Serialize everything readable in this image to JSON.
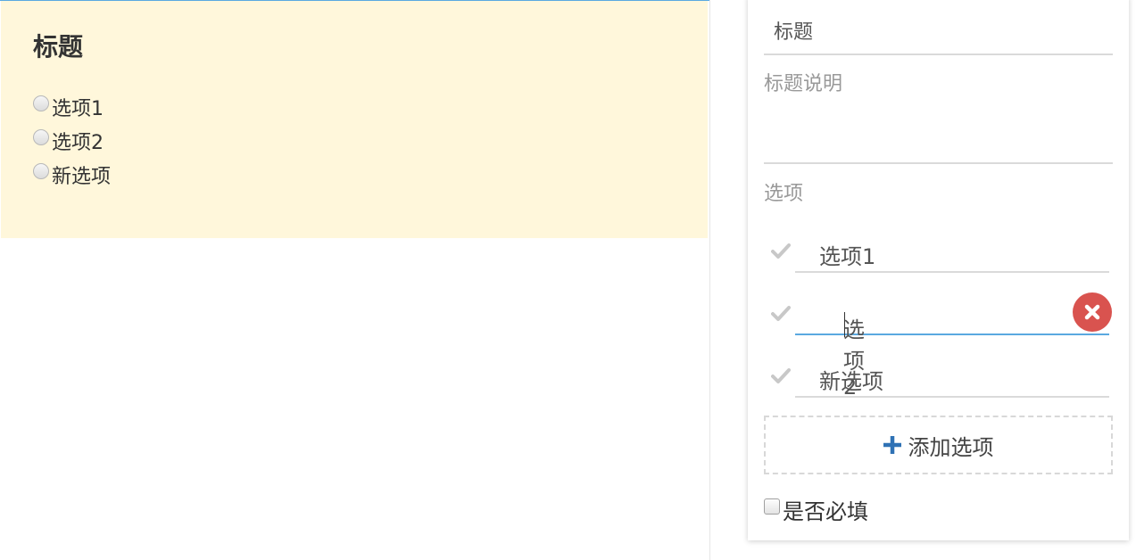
{
  "preview": {
    "title": "标题",
    "options": [
      "选项1",
      "选项2",
      "新选项"
    ]
  },
  "editor": {
    "title_value": "标题",
    "description_label": "标题说明",
    "options_label": "选项",
    "options": [
      "选项1",
      "选项2",
      "新选项"
    ],
    "add_option_label": "添加选项",
    "required_label": "是否必填"
  },
  "icons": {
    "check": "check-icon",
    "delete": "close-circle-icon",
    "add": "plus-icon"
  },
  "colors": {
    "preview_bg": "#fff7db",
    "accent": "#5aa9e0",
    "delete": "#d9534f",
    "plus": "#2f72b5"
  }
}
